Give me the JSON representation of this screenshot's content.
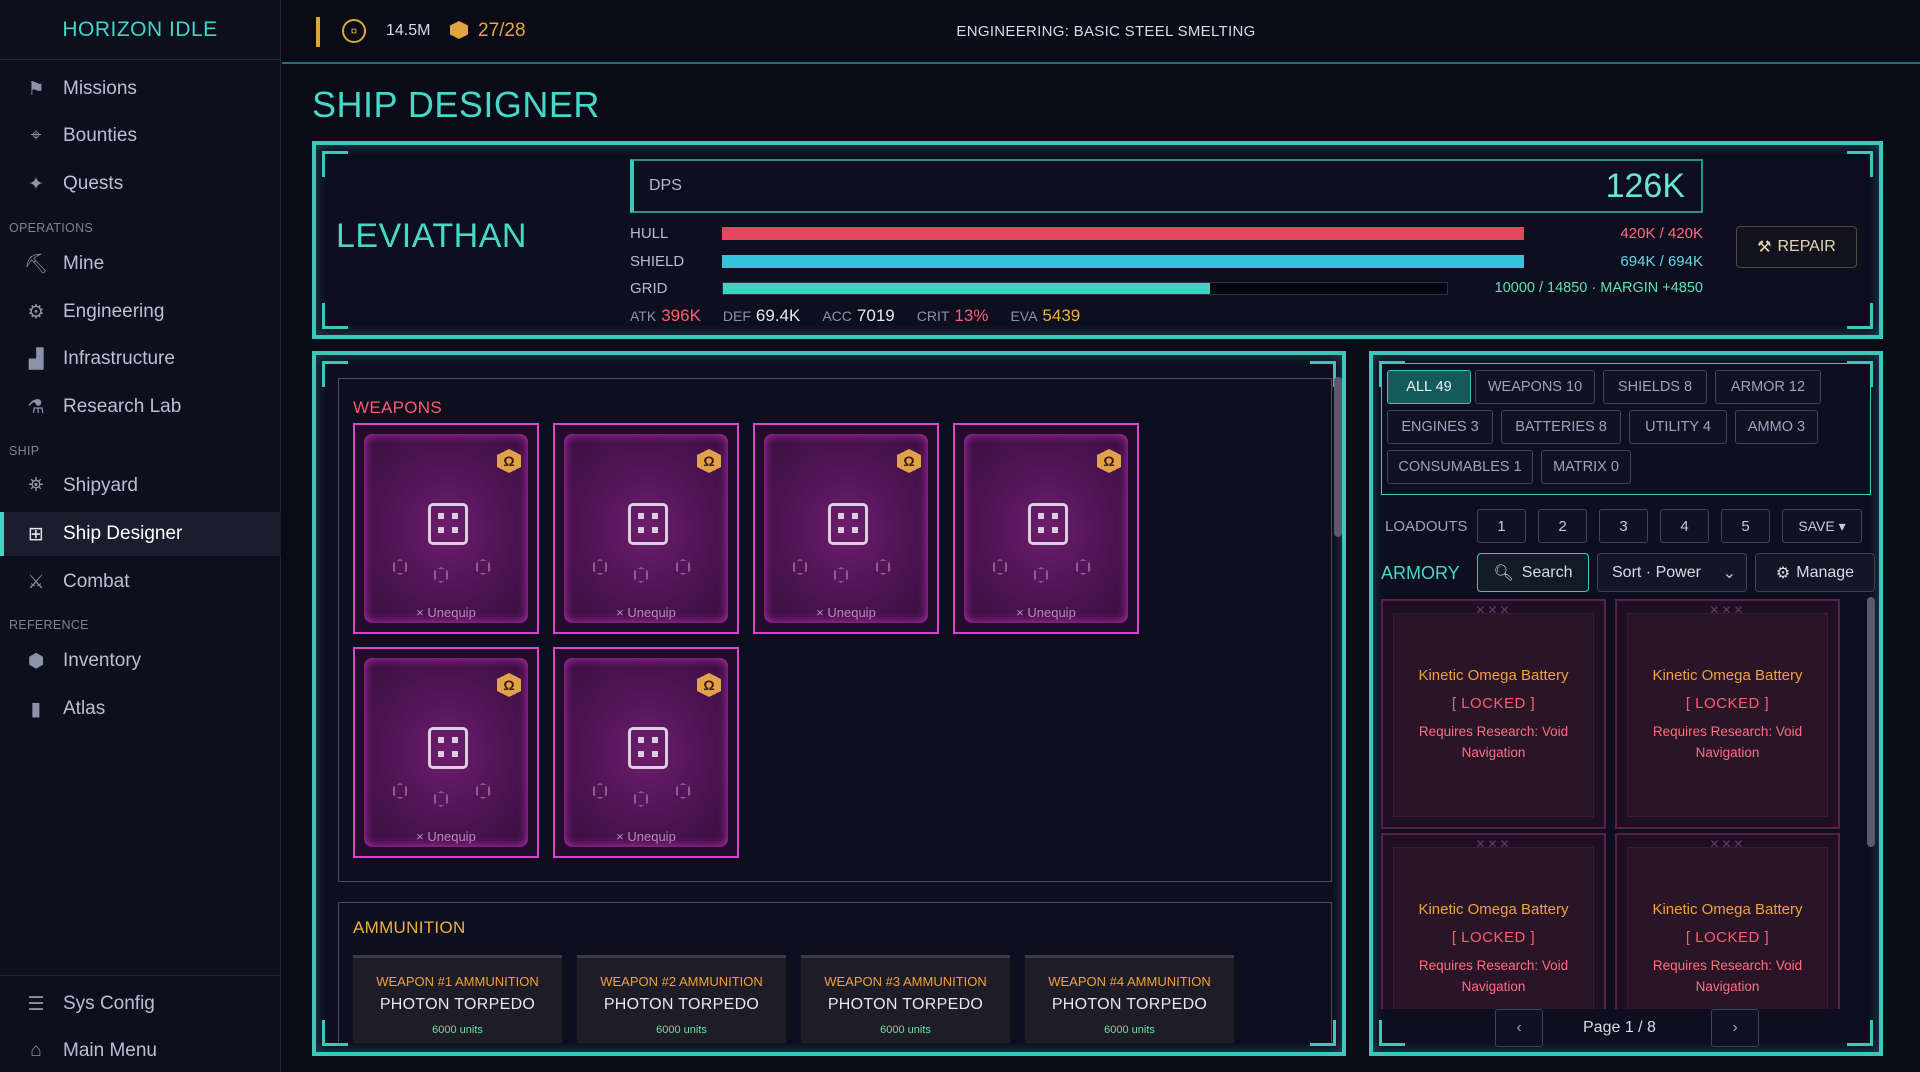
{
  "app": {
    "title": "HORIZON IDLE"
  },
  "nav": {
    "top_items": [
      {
        "label": "Missions",
        "icon": "flag-icon"
      },
      {
        "label": "Bounties",
        "icon": "crosshair-icon"
      },
      {
        "label": "Quests",
        "icon": "sparkle-icon"
      }
    ],
    "sections": {
      "operations": "OPERATIONS",
      "ship": "SHIP",
      "reference": "REFERENCE"
    },
    "operations_items": [
      {
        "label": "Mine",
        "icon": "pickaxe-icon"
      },
      {
        "label": "Engineering",
        "icon": "gear-icon"
      },
      {
        "label": "Infrastructure",
        "icon": "factory-icon"
      },
      {
        "label": "Research Lab",
        "icon": "flask-icon"
      }
    ],
    "ship_items": [
      {
        "label": "Shipyard",
        "icon": "shipyard-icon"
      },
      {
        "label": "Ship Designer",
        "icon": "grid-icon",
        "active": true
      },
      {
        "label": "Combat",
        "icon": "swords-icon"
      }
    ],
    "reference_items": [
      {
        "label": "Inventory",
        "icon": "cube-icon"
      },
      {
        "label": "Atlas",
        "icon": "book-icon"
      }
    ],
    "bottom_items": [
      {
        "label": "Sys Config",
        "icon": "sliders-icon"
      },
      {
        "label": "Main Menu",
        "icon": "home-icon"
      }
    ]
  },
  "topbar": {
    "credits": "14.5M",
    "cargo": "27/28",
    "engineering_status": "ENGINEERING: BASIC STEEL SMELTING"
  },
  "page": {
    "title": "SHIP DESIGNER"
  },
  "ship": {
    "name": "LEVIATHAN",
    "dps_label": "DPS",
    "dps_value": "126K",
    "hull": {
      "label": "HULL",
      "value": "420K / 420K",
      "fill": 1.0
    },
    "shield": {
      "label": "SHIELD",
      "value": "694K / 694K",
      "fill": 1.0
    },
    "grid": {
      "label": "GRID",
      "value": "10000 / 14850 · MARGIN +4850",
      "fill": 0.673
    },
    "stats": [
      {
        "label": "ATK",
        "value": "396K",
        "color": "#ff5d6e"
      },
      {
        "label": "DEF",
        "value": "69.4K",
        "color": "#e6e8ee"
      },
      {
        "label": "ACC",
        "value": "7019",
        "color": "#e6e8ee"
      },
      {
        "label": "CRIT",
        "value": "13%",
        "color": "#ff5d6e"
      },
      {
        "label": "EVA",
        "value": "5439",
        "color": "#f0b13c"
      }
    ],
    "repair_label": "REPAIR"
  },
  "colors": {
    "hull": "#e5485c",
    "shield": "#36c3dc",
    "grid": "#3cd3c0",
    "accent": "#3cc7bd"
  },
  "weapons": {
    "title": "WEAPONS",
    "unequip_label": "× Unequip",
    "slot_count": 6
  },
  "ammunition": {
    "title": "AMMUNITION",
    "cards": [
      {
        "title": "WEAPON #1 AMMUNITION",
        "name": "PHOTON TORPEDO",
        "units": "6000 units"
      },
      {
        "title": "WEAPON #2 AMMUNITION",
        "name": "PHOTON TORPEDO",
        "units": "6000 units"
      },
      {
        "title": "WEAPON #3 AMMUNITION",
        "name": "PHOTON TORPEDO",
        "units": "6000 units"
      },
      {
        "title": "WEAPON #4 AMMUNITION",
        "name": "PHOTON TORPEDO",
        "units": "6000 units"
      }
    ]
  },
  "armory": {
    "filters": [
      {
        "label": "ALL 49",
        "active": true
      },
      {
        "label": "WEAPONS 10"
      },
      {
        "label": "SHIELDS 8"
      },
      {
        "label": "ARMOR 12"
      },
      {
        "label": "ENGINES 3"
      },
      {
        "label": "BATTERIES 8"
      },
      {
        "label": "UTILITY 4"
      },
      {
        "label": "AMMO 3"
      },
      {
        "label": "CONSUMABLES 1"
      },
      {
        "label": "MATRIX 0"
      }
    ],
    "loadouts_label": "LOADOUTS",
    "loadouts": [
      "1",
      "2",
      "3",
      "4",
      "5",
      "SAVE ▾"
    ],
    "label": "ARMORY",
    "search_label": "Search",
    "sort_label": "Sort · Power",
    "manage_label": "Manage",
    "items": [
      {
        "name": "Kinetic Omega Battery",
        "status": "[ LOCKED ]",
        "requirement": "Requires Research: Void Navigation"
      },
      {
        "name": "Kinetic Omega Battery",
        "status": "[ LOCKED ]",
        "requirement": "Requires Research: Void Navigation"
      },
      {
        "name": "Kinetic Omega Battery",
        "status": "[ LOCKED ]",
        "requirement": "Requires Research: Void Navigation"
      },
      {
        "name": "Kinetic Omega Battery",
        "status": "[ LOCKED ]",
        "requirement": "Requires Research: Void Navigation"
      }
    ],
    "pager": {
      "prev": "‹",
      "next": "›",
      "label": "Page 1 / 8"
    }
  }
}
